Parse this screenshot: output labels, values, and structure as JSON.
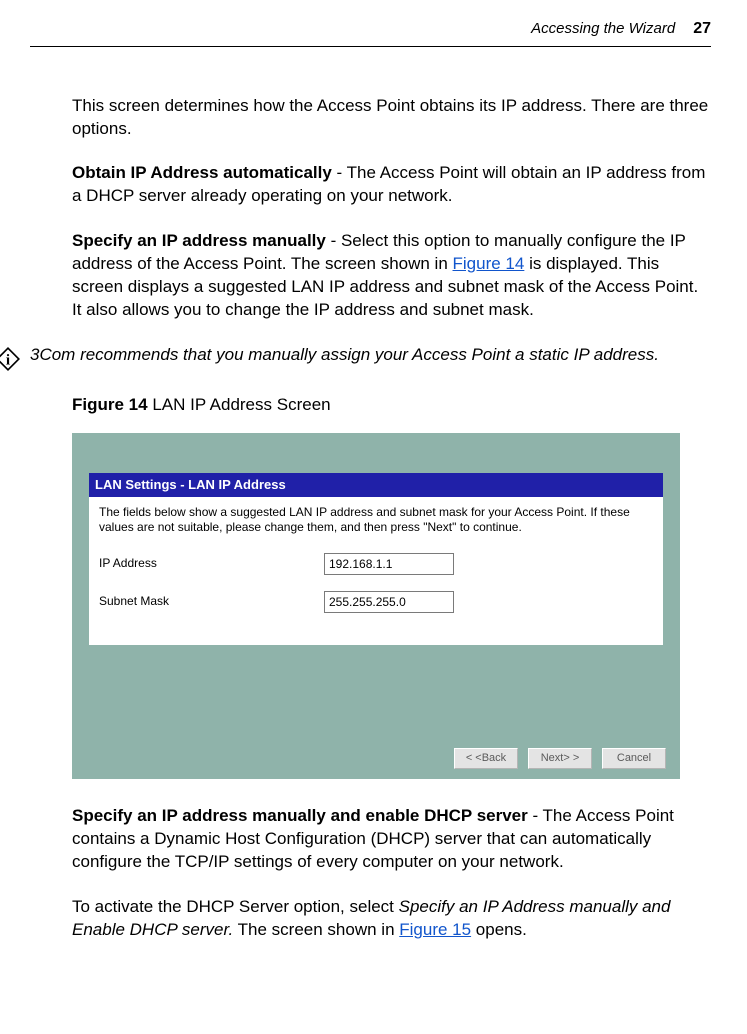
{
  "header": {
    "section": "Accessing the Wizard",
    "page": "27"
  },
  "para_intro": "This screen determines how the Access Point obtains its IP address. There are three options.",
  "opt1": {
    "title": "Obtain IP Address automatically",
    "text": " - The Access Point will obtain an IP address from a DHCP server already operating on your network."
  },
  "opt2": {
    "title": "Specify an IP address manually",
    "pre": " - Select this option to manually configure the IP address of the Access Point. The screen shown in ",
    "link": "Figure 14",
    "post": " is displayed. This screen displays a suggested LAN IP address and subnet mask of the Access Point. It also allows you to change the IP address and subnet mask."
  },
  "note": "3Com recommends that you manually assign your Access Point a static IP address.",
  "figure14": {
    "label_prefix": "Figure 14",
    "label_text": "   LAN IP Address Screen",
    "dialog_title": "LAN Settings - LAN IP Address",
    "dialog_body": "The fields below show a suggested LAN IP address and subnet mask for your Access Point. If these values are not suitable, please change them, and then press \"Next\" to continue.",
    "rows": [
      {
        "label": "IP Address",
        "value": "192.168.1.1"
      },
      {
        "label": "Subnet Mask",
        "value": "255.255.255.0"
      }
    ],
    "buttons": {
      "back": "< <Back",
      "next": "Next> >",
      "cancel": "Cancel"
    }
  },
  "opt3": {
    "title": "Specify an IP address manually and enable DHCP server",
    "text": " - The Access Point contains a Dynamic Host Configuration (DHCP) server that can automatically configure the TCP/IP settings of every computer on your network."
  },
  "para_activate": {
    "pre": "To activate the DHCP Server option, select ",
    "ital": "Specify an IP Address manually and Enable DHCP server.",
    "mid": " The screen shown in ",
    "link": "Figure 15",
    "post": " opens."
  }
}
